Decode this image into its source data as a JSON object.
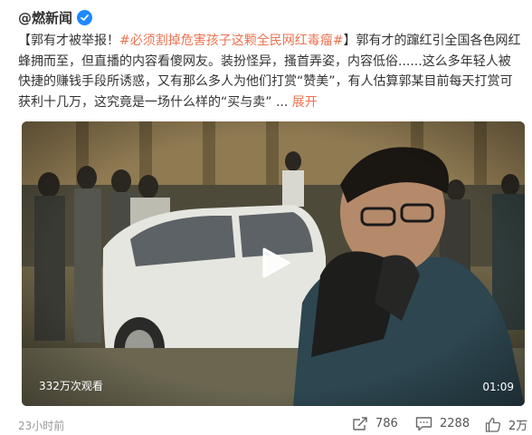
{
  "author": {
    "name": "@燃新闻",
    "verified_color": "#1e88ff"
  },
  "post": {
    "bracket_open": "【",
    "title": "郭有才被举报！",
    "hashtag": "#必须割掉危害孩子这颗全民网红毒瘤#",
    "bracket_close": "】",
    "body": "郭有才的蹿红引全国各色网红蜂拥而至，但直播的内容看傻网友。装扮怪异，搔首弄姿，内容低俗......这么多年轻人被快捷的赚钱手段所诱惑，又有那么多人为他们打赏“赞美”，有人估算郭某目前每天打赏可获利十几万，这究竟是一场什么样的“买与卖”",
    "ellipsis": " ... ",
    "expand_label": "展开",
    "accent_color": "#eb7350"
  },
  "video": {
    "views": "332万次观看",
    "duration": "01:09",
    "play_icon": "play-icon"
  },
  "footer": {
    "time": "23小时前",
    "repost_count": "786",
    "comment_count": "2288",
    "like_count": "2万"
  }
}
